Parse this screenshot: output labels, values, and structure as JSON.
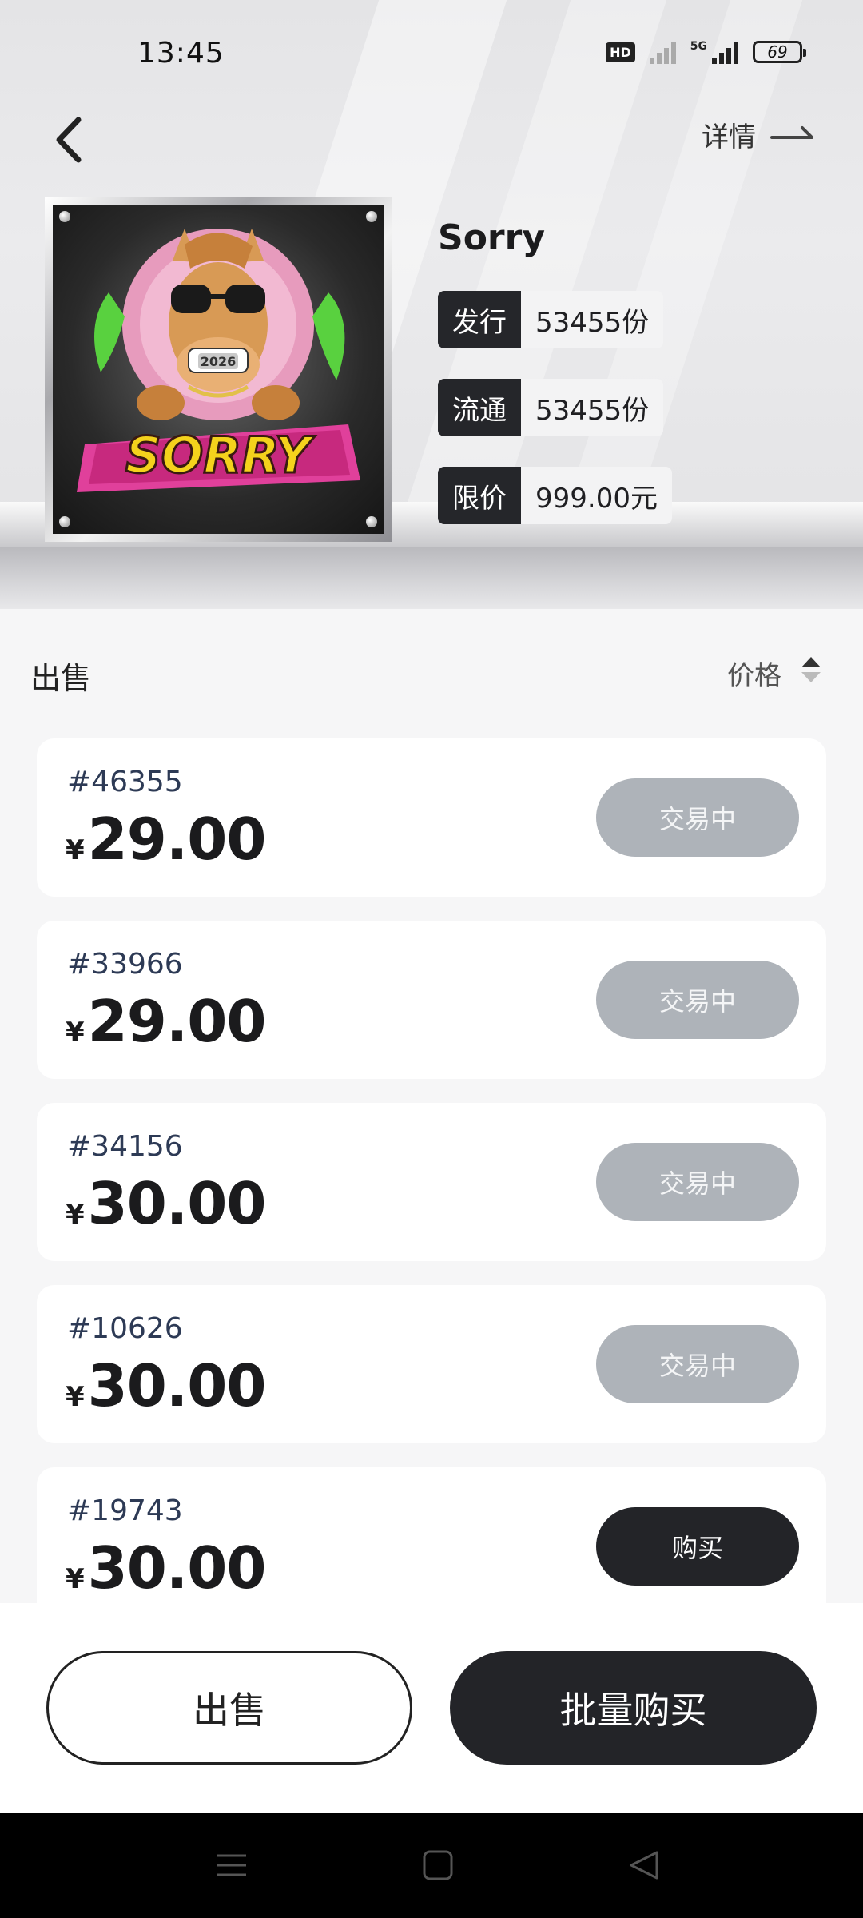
{
  "status_bar": {
    "time": "13:45",
    "hd_label": "HD",
    "network_label": "5G",
    "battery": "69"
  },
  "nav": {
    "details_label": "详情"
  },
  "nft": {
    "title": "Sorry",
    "artwork_text": "SORRY",
    "artwork_badge": "2026",
    "info": [
      {
        "key": "发行",
        "value": "53455份"
      },
      {
        "key": "流通",
        "value": "53455份"
      },
      {
        "key": "限价",
        "value": "999.00元"
      }
    ]
  },
  "sale": {
    "title": "出售",
    "sort_label": "价格",
    "currency": "¥",
    "listings": [
      {
        "id": "#46355",
        "price": "29.00",
        "action": "交易中",
        "state": "pending"
      },
      {
        "id": "#33966",
        "price": "29.00",
        "action": "交易中",
        "state": "pending"
      },
      {
        "id": "#34156",
        "price": "30.00",
        "action": "交易中",
        "state": "pending"
      },
      {
        "id": "#10626",
        "price": "30.00",
        "action": "交易中",
        "state": "pending"
      },
      {
        "id": "#19743",
        "price": "30.00",
        "action": "购买",
        "state": "buy"
      }
    ]
  },
  "bottom": {
    "sell_label": "出售",
    "bulk_buy_label": "批量购买"
  },
  "colors": {
    "dark": "#232428",
    "pending_button": "#aeb3b9",
    "id_text": "#2d3a55"
  }
}
